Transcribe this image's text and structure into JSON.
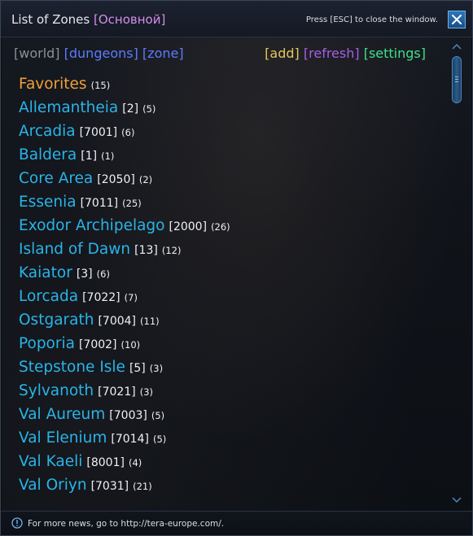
{
  "window": {
    "title": "List of Zones",
    "title_tag": "[Основной]",
    "esc_hint": "Press [ESC] to close the window.",
    "close_icon": "close-x-icon"
  },
  "nav": {
    "world": "[world]",
    "dungeons": "[dungeons]",
    "zone": "[zone]",
    "add": "[add]",
    "refresh": "[refresh]",
    "settings": "[settings]"
  },
  "favorites": {
    "label": "Favorites",
    "count": "(15)"
  },
  "zones": [
    {
      "name": "Allemantheia",
      "id": "[2]",
      "count": "(5)"
    },
    {
      "name": "Arcadia",
      "id": "[7001]",
      "count": "(6)"
    },
    {
      "name": "Baldera",
      "id": "[1]",
      "count": "(1)"
    },
    {
      "name": "Core Area",
      "id": "[2050]",
      "count": "(2)"
    },
    {
      "name": "Essenia",
      "id": "[7011]",
      "count": "(25)"
    },
    {
      "name": "Exodor Archipelago",
      "id": "[2000]",
      "count": "(26)"
    },
    {
      "name": "Island of Dawn",
      "id": "[13]",
      "count": "(12)"
    },
    {
      "name": "Kaiator",
      "id": "[3]",
      "count": "(6)"
    },
    {
      "name": "Lorcada",
      "id": "[7022]",
      "count": "(7)"
    },
    {
      "name": "Ostgarath",
      "id": "[7004]",
      "count": "(11)"
    },
    {
      "name": "Poporia",
      "id": "[7002]",
      "count": "(10)"
    },
    {
      "name": "Stepstone Isle",
      "id": "[5]",
      "count": "(3)"
    },
    {
      "name": "Sylvanoth",
      "id": "[7021]",
      "count": "(3)"
    },
    {
      "name": "Val Aureum",
      "id": "[7003]",
      "count": "(5)"
    },
    {
      "name": "Val Elenium",
      "id": "[7014]",
      "count": "(5)"
    },
    {
      "name": "Val Kaeli",
      "id": "[8001]",
      "count": "(4)"
    },
    {
      "name": "Val Oriyn",
      "id": "[7031]",
      "count": "(21)"
    }
  ],
  "footer": {
    "text": "For more news, go to http://tera-europe.com/.",
    "icon": "info-icon"
  },
  "colors": {
    "zone": "#2ab4e8",
    "favorites": "#f0a035",
    "title_accent": "#d58ee8",
    "world": "#8f8f8f",
    "dungeons": "#5d7bff",
    "add": "#e3c85a",
    "refresh": "#a45fe6",
    "settings": "#3ee08a"
  }
}
